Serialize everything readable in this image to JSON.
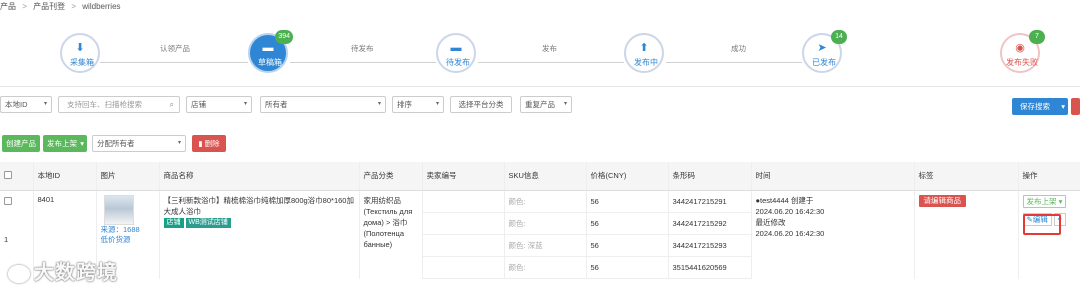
{
  "breadcrumb": [
    "产品",
    "产品刊登",
    "wildberries"
  ],
  "breadcrumb_sep": ">",
  "flow": {
    "steps": [
      {
        "label": "采集箱",
        "icon": "download-icon",
        "glyph": "⬇",
        "badge": ""
      },
      {
        "label": "草稿箱",
        "icon": "folder-icon",
        "glyph": "▬",
        "badge": "394"
      },
      {
        "label": "待发布",
        "icon": "folder-icon",
        "glyph": "▬",
        "badge": ""
      },
      {
        "label": "发布中",
        "icon": "upload-icon",
        "glyph": "⬆",
        "badge": ""
      },
      {
        "label": "已发布",
        "icon": "send-icon",
        "glyph": "➤",
        "badge": "14"
      },
      {
        "label": "发布失败",
        "icon": "eye-slash-icon",
        "glyph": "◉",
        "badge": "7"
      }
    ],
    "connectors": [
      "认领产品",
      "待发布",
      "发布",
      "成功"
    ]
  },
  "filters": {
    "local_id": "本地ID",
    "search_placeholder": "支持回车、扫描枪搜索",
    "search_icon": "search-icon",
    "store": "店铺",
    "owner": "所有者",
    "sort": "排序",
    "select_category": "选择平台分类",
    "dup_product": "重复产品",
    "save_search": "保存搜索",
    "caret": "▾"
  },
  "actions": {
    "create": "创建产品",
    "publish": "发布上架",
    "assign": "分配所有者",
    "delete": "删除",
    "delete_icon": "trash-icon",
    "caret": "▾"
  },
  "table": {
    "headers": [
      "",
      "本地ID",
      "图片",
      "商品名称",
      "产品分类",
      "卖家编号",
      "SKU信息",
      "价格(CNY)",
      "条形码",
      "时间",
      "标签",
      "操作"
    ],
    "row": {
      "local_id": "8401",
      "row_index": "1",
      "source": "来源：1688",
      "lowest_price": "低价货源",
      "name": "【三利新款浴巾】精梳棉浴巾纯棉加厚800g浴巾80*160加大成人浴巾",
      "tags": [
        "店铺",
        "WB测试店铺"
      ],
      "category": "家用纺织品 (Текстиль для дома) > 浴巾 (Полотенца банные)",
      "skus": [
        {
          "spec": "颜色:",
          "price": "56",
          "barcode": "3442417215291"
        },
        {
          "spec": "颜色:",
          "price": "56",
          "barcode": "3442417215292"
        },
        {
          "spec": "颜色: 深蓝",
          "price": "56",
          "barcode": "3442417215293"
        },
        {
          "spec": "颜色:",
          "price": "56",
          "barcode": "3515441620569"
        }
      ],
      "time": {
        "creator": "test4444 创建于",
        "created": "2024.06.20 16:42:30",
        "modified_label": "最近修改",
        "modified": "2024.06.20 16:42:30"
      },
      "label_tag": "请编辑商品",
      "op_publish": "发布上架",
      "op_edit": "编辑",
      "edit_icon": "pencil-icon"
    }
  },
  "watermark": "大数跨境"
}
